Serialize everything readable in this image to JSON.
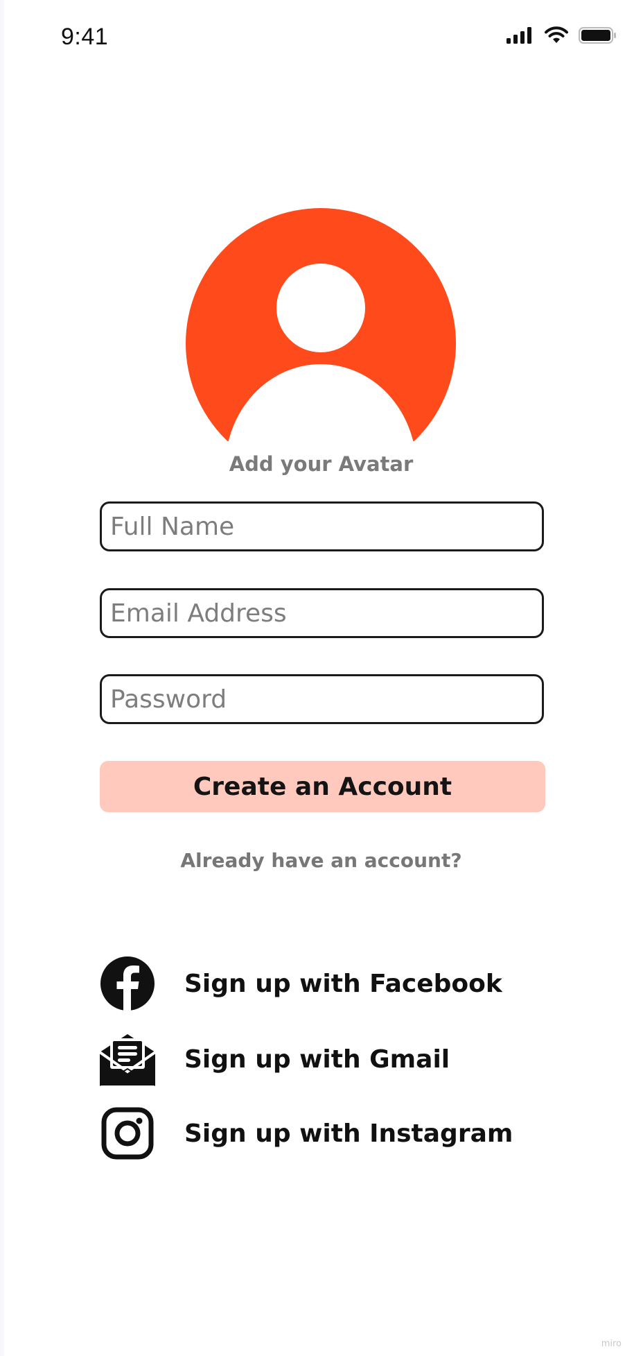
{
  "status_bar": {
    "time": "9:41",
    "icons": [
      "signal-icon",
      "wifi-icon",
      "battery-icon"
    ]
  },
  "avatar": {
    "label": "Add your Avatar",
    "icon": "person-avatar-icon",
    "color": "#ff4a1c"
  },
  "form": {
    "full_name": {
      "placeholder": "Full Name",
      "value": ""
    },
    "email": {
      "placeholder": "Email Address",
      "value": ""
    },
    "password": {
      "placeholder": "Password",
      "value": ""
    },
    "submit_label": "Create an Account",
    "submit_color": "#ffc9bd",
    "login_link": "Already have an account?"
  },
  "social": [
    {
      "label": "Sign up with Facebook",
      "icon": "facebook-icon"
    },
    {
      "label": "Sign up with Gmail",
      "icon": "gmail-icon"
    },
    {
      "label": "Sign up with Instagram",
      "icon": "instagram-icon"
    }
  ],
  "watermark": "miro"
}
